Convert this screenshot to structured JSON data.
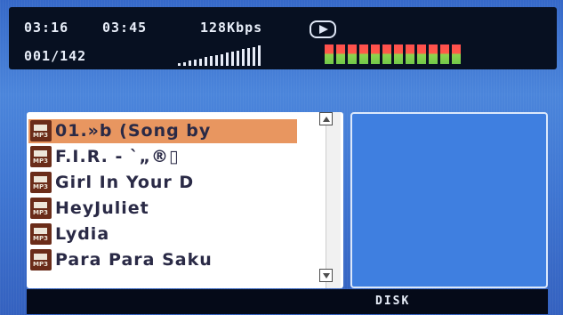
{
  "status": {
    "elapsed": "03:16",
    "total": "03:45",
    "bitrate": "128Kbps",
    "track_counter": "001/142",
    "play_icon": "play-icon",
    "volume_level_bars": 16,
    "equalizer_bars": 12
  },
  "playlist": {
    "items": [
      {
        "label": "01.»b (Song by",
        "icon": "mp3-file-icon",
        "selected": true
      },
      {
        "label": "F.I.R. - `„®▯",
        "icon": "mp3-file-icon",
        "selected": false
      },
      {
        "label": "Girl In Your D",
        "icon": "mp3-file-icon",
        "selected": false
      },
      {
        "label": "HeyJuliet",
        "icon": "mp3-file-icon",
        "selected": false
      },
      {
        "label": "Lydia",
        "icon": "mp3-file-icon",
        "selected": false
      },
      {
        "label": "Para Para Saku",
        "icon": "mp3-file-icon",
        "selected": false
      }
    ],
    "selection_color": "#e89660"
  },
  "footer": {
    "source": "DISK"
  },
  "colors": {
    "background": "#3f74cf",
    "bar": "#071021",
    "text": "#e8eef9"
  }
}
